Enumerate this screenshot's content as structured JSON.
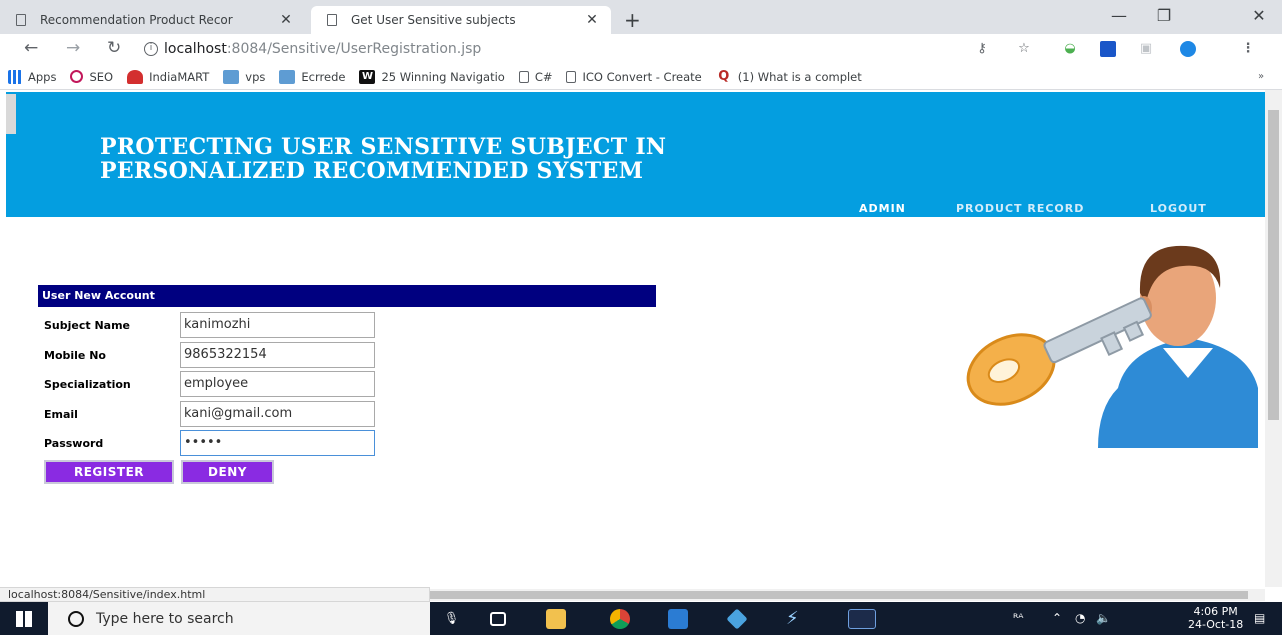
{
  "browser": {
    "tabs": [
      {
        "title": "Recommendation Product Recor",
        "active": false
      },
      {
        "title": "Get User Sensitive subjects",
        "active": true
      }
    ],
    "url_host": "localhost",
    "url_path": ":8084/Sensitive/UserRegistration.jsp",
    "bookmarks": [
      {
        "label": "Apps",
        "icon": "apps-grid-icon"
      },
      {
        "label": "SEO",
        "icon": "seo-icon"
      },
      {
        "label": "IndiaMART",
        "icon": "indiamart-icon"
      },
      {
        "label": "vps",
        "icon": "vps-icon"
      },
      {
        "label": "Ecrrede",
        "icon": "ecrrede-icon"
      },
      {
        "label": "25 Winning Navigatio",
        "icon": "word-icon"
      },
      {
        "label": "C#",
        "icon": "page-icon"
      },
      {
        "label": "ICO Convert - Create",
        "icon": "page-icon"
      },
      {
        "label": "(1) What is a complet",
        "icon": "quora-icon"
      }
    ],
    "status_url": "localhost:8084/Sensitive/index.html"
  },
  "page": {
    "title_line1": "PROTECTING USER SENSITIVE SUBJECT IN",
    "title_line2": "PERSONALIZED RECOMMENDED SYSTEM",
    "nav": {
      "admin": "ADMIN",
      "product_record": "PRODUCT RECORD",
      "logout": "LOGOUT"
    },
    "form": {
      "heading": "User New Account",
      "fields": [
        {
          "label": "Subject Name",
          "value": "kanimozhi"
        },
        {
          "label": "Mobile No",
          "value": "9865322154"
        },
        {
          "label": "Specialization",
          "value": "employee"
        },
        {
          "label": "Email",
          "value": "kani@gmail.com"
        },
        {
          "label": "Password",
          "value": "•••••"
        }
      ],
      "register_label": "REGISTER",
      "deny_label": "DENY"
    }
  },
  "taskbar": {
    "search_placeholder": "Type here to search",
    "time": "4:06 PM",
    "date": "24-Oct-18"
  },
  "colors": {
    "banner": "#049ee0",
    "form_header": "#000080",
    "button": "#8a2be2"
  }
}
